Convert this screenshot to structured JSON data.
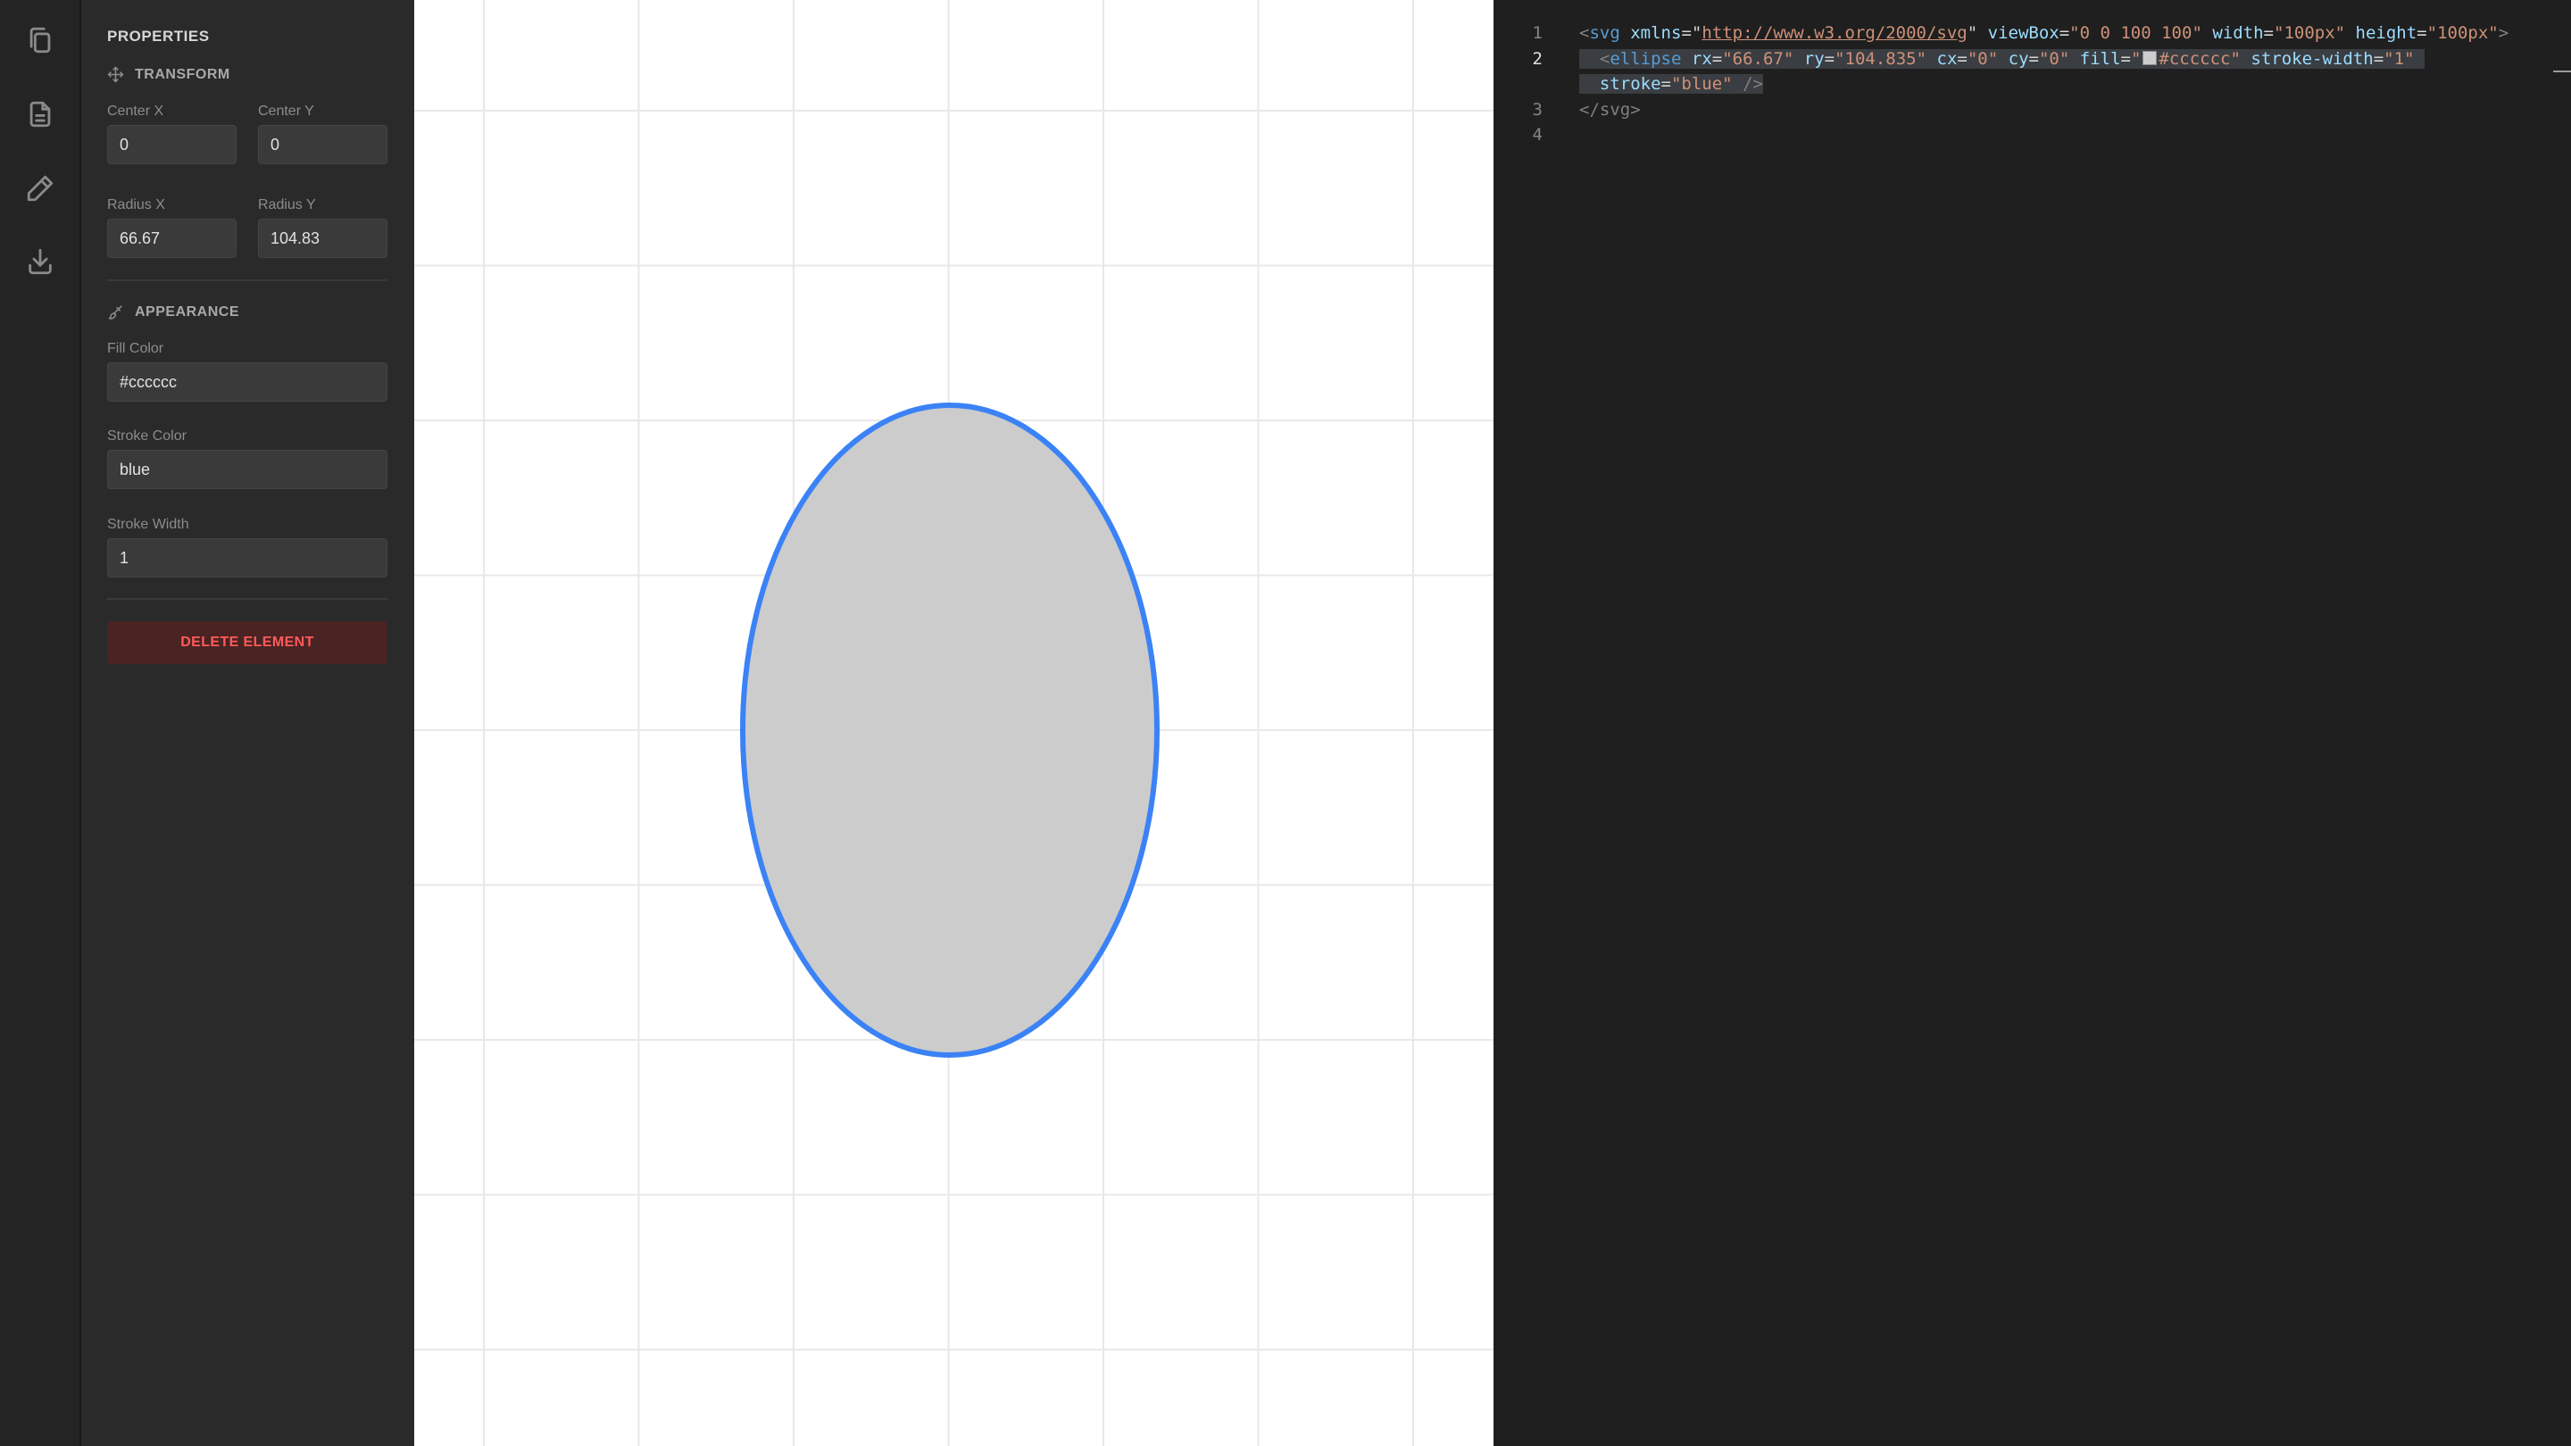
{
  "rail": {
    "icons": [
      "copy-icon",
      "file-icon",
      "pencil-icon",
      "download-icon"
    ]
  },
  "panel": {
    "title": "PROPERTIES",
    "transform": {
      "heading": "TRANSFORM",
      "center_x_label": "Center X",
      "center_x_value": "0",
      "center_y_label": "Center Y",
      "center_y_value": "0",
      "radius_x_label": "Radius X",
      "radius_x_value": "66.67",
      "radius_y_label": "Radius Y",
      "radius_y_value": "104.83"
    },
    "appearance": {
      "heading": "APPEARANCE",
      "fill_label": "Fill Color",
      "fill_value": "#cccccc",
      "stroke_label": "Stroke Color",
      "stroke_value": "blue",
      "stroke_width_label": "Stroke Width",
      "stroke_width_value": "1"
    },
    "delete_label": "DELETE ELEMENT"
  },
  "canvas": {
    "ellipse_fill": "#cccccc",
    "ellipse_stroke": "#3b82f6",
    "grid_color": "#e8e8e8"
  },
  "editor": {
    "line_numbers": [
      "1",
      "2",
      "3",
      "4"
    ],
    "active_line": "2",
    "line1": {
      "open": "<",
      "tag": "svg",
      "xmlns_attr": "xmlns",
      "xmlns_val": "http://www.w3.org/2000/svg",
      "viewbox_attr": "viewBox",
      "viewbox_val": "\"0 0 100 100\"",
      "width_attr": "width",
      "width_val": "\"100px\"",
      "height_attr": "height",
      "height_val": "\"100px\"",
      "close": ">"
    },
    "line2": {
      "tag": "ellipse",
      "rx_attr": "rx",
      "rx_val": "\"66.67\"",
      "ry_attr": "ry",
      "ry_val": "\"104.835\"",
      "cx_attr": "cx",
      "cx_val": "\"0\"",
      "cy_attr": "cy",
      "cy_val": "\"0\"",
      "fill_attr": "fill",
      "fill_val": "#cccccc",
      "stroke_width_attr": "stroke-width",
      "stroke_width_val": "\"1\""
    },
    "line2b": {
      "stroke_attr": "stroke",
      "stroke_val": "\"blue\"",
      "self_close": "/>"
    },
    "line3": {
      "close_tag": "</svg>"
    }
  }
}
